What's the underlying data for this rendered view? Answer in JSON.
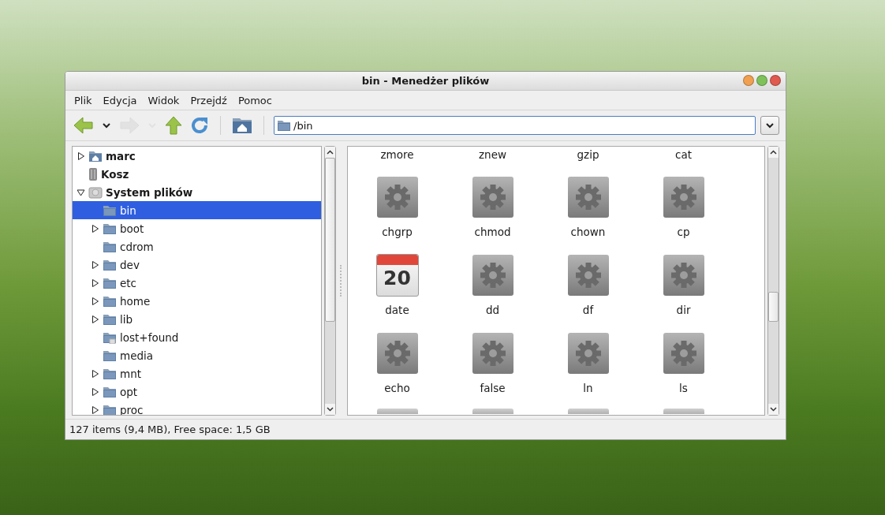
{
  "window": {
    "title": "bin - Menedżer plików"
  },
  "menu": [
    {
      "label": "Plik"
    },
    {
      "label": "Edycja"
    },
    {
      "label": "Widok"
    },
    {
      "label": "Przejdź"
    },
    {
      "label": "Pomoc"
    }
  ],
  "toolbar": [
    {
      "kind": "back",
      "disabled": false
    },
    {
      "kind": "dropdown",
      "disabled": false
    },
    {
      "kind": "forward",
      "disabled": true
    },
    {
      "kind": "dropdown",
      "disabled": true
    },
    {
      "kind": "up",
      "disabled": false
    },
    {
      "kind": "reload",
      "disabled": false
    },
    {
      "kind": "separator"
    },
    {
      "kind": "home",
      "disabled": false
    },
    {
      "kind": "separator"
    }
  ],
  "location": {
    "value": "/bin"
  },
  "sidebar": {
    "items": [
      {
        "label": "marc",
        "kind": "home",
        "expanded": false,
        "selected": false
      },
      {
        "label": "Kosz",
        "kind": "trash",
        "selected": false
      },
      {
        "label": "System plików",
        "kind": "drive",
        "expanded": true,
        "selected": false,
        "children": [
          {
            "label": "bin",
            "kind": "folder",
            "selected": true
          },
          {
            "label": "boot",
            "kind": "folder",
            "expanded": false,
            "selected": false
          },
          {
            "label": "cdrom",
            "kind": "folder",
            "selected": false
          },
          {
            "label": "dev",
            "kind": "folder",
            "expanded": false,
            "selected": false
          },
          {
            "label": "etc",
            "kind": "folder",
            "expanded": false,
            "selected": false
          },
          {
            "label": "home",
            "kind": "folder",
            "expanded": false,
            "selected": false
          },
          {
            "label": "lib",
            "kind": "folder",
            "expanded": false,
            "selected": false
          },
          {
            "label": "lost+found",
            "kind": "locked-folder",
            "selected": false
          },
          {
            "label": "media",
            "kind": "folder",
            "selected": false
          },
          {
            "label": "mnt",
            "kind": "folder",
            "expanded": false,
            "selected": false
          },
          {
            "label": "opt",
            "kind": "folder",
            "expanded": false,
            "selected": false
          },
          {
            "label": "proc",
            "kind": "folder",
            "expanded": false,
            "selected": false
          }
        ]
      }
    ]
  },
  "files": [
    {
      "label": "zmore",
      "kind": "label-only"
    },
    {
      "label": "znew",
      "kind": "label-only"
    },
    {
      "label": "gzip",
      "kind": "label-only"
    },
    {
      "label": "cat",
      "kind": "label-only"
    },
    {
      "label": "chgrp",
      "kind": "executable"
    },
    {
      "label": "chmod",
      "kind": "executable"
    },
    {
      "label": "chown",
      "kind": "executable"
    },
    {
      "label": "cp",
      "kind": "executable"
    },
    {
      "label": "date",
      "kind": "calendar",
      "calendar_day": "20"
    },
    {
      "label": "dd",
      "kind": "executable"
    },
    {
      "label": "df",
      "kind": "executable"
    },
    {
      "label": "dir",
      "kind": "executable"
    },
    {
      "label": "echo",
      "kind": "executable"
    },
    {
      "label": "false",
      "kind": "executable"
    },
    {
      "label": "ln",
      "kind": "executable"
    },
    {
      "label": "ls",
      "kind": "executable"
    },
    {
      "kind": "partial"
    },
    {
      "kind": "partial"
    },
    {
      "kind": "partial"
    },
    {
      "kind": "partial"
    }
  ],
  "status_bar": {
    "text": "127 items (9,4 MB), Free space: 1,5 GB"
  }
}
